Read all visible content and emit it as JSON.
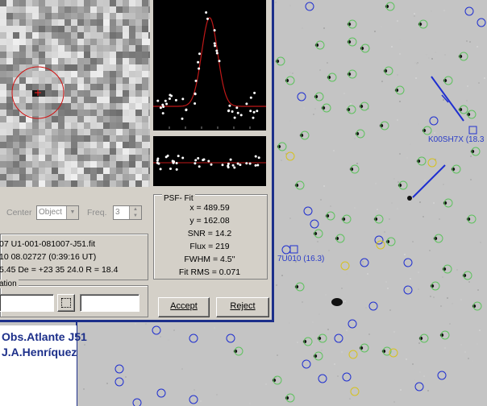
{
  "zoom_view": {
    "name": "zoomed star image"
  },
  "profile": {
    "name": "star profile plot"
  },
  "residuals": {
    "name": "fit residuals plot"
  },
  "controls": {
    "center_label": "Center",
    "center_value": "Object",
    "freq_label": "Freq.",
    "freq_value": "3"
  },
  "image_info": {
    "file_name": "07 U1-001-081007-J51.fit",
    "date": "10 08.02727 (0:39:16 UT)",
    "coords": "5.45  De = +23 35 24.0  R = 18.4"
  },
  "identification": {
    "title": "ation"
  },
  "psf_fit": {
    "title": "PSF- Fit",
    "x": "x = 489.59",
    "y": "y = 162.08",
    "snr": "SNR = 14.2",
    "flux": "Flux = 219",
    "fwhm": "FWHM = 4.5''",
    "fit_rms": "Fit RMS = 0.071"
  },
  "buttons": {
    "accept": "Accept",
    "reject": "Reject"
  },
  "observatory": {
    "line1": "Obs.Atlante  J51",
    "line2": "J.A.Henríquez"
  },
  "sky_labels": {
    "target": "K00SH7X (18.3",
    "other": "7U010 (16.3)"
  },
  "colors": {
    "accent": "#1c2f8a",
    "circle_blue": "#1f2fd0",
    "circle_green": "#5ec25e",
    "circle_yellow": "#d6c21e"
  }
}
